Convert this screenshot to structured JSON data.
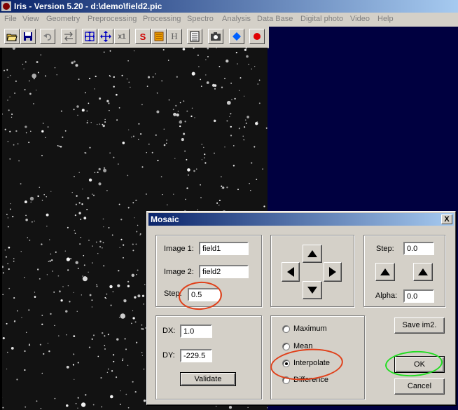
{
  "window": {
    "title": "Iris - Version 5.20 - d:\\demo\\field2.pic"
  },
  "menu": [
    "File",
    "View",
    "Geometry",
    "Preprocessing",
    "Processing",
    "Spectro",
    "Analysis",
    "Data Base",
    "Digital photo",
    "Video",
    "Help"
  ],
  "toolbar": {
    "icons": [
      "open-folder-icon",
      "save-disk-icon",
      "undo-icon",
      "transfer-icon",
      "zoom-in-icon",
      "move-cross-icon",
      "zoom-x1-icon",
      "red-s-icon",
      "histogram-icon",
      "header-icon",
      "list-icon",
      "camera-icon",
      "blue-diamond-icon",
      "red-dot-icon"
    ],
    "x1_label": "x1",
    "h_label": "H",
    "s_label": "S"
  },
  "mosaic": {
    "title": "Mosaic",
    "close": "X",
    "image1_label": "Image 1:",
    "image1_value": "field1",
    "image2_label": "Image 2:",
    "image2_value": "field2",
    "step_label": "Step:",
    "step_value": "0.5",
    "dx_label": "DX:",
    "dx_value": "1.0",
    "dy_label": "DY:",
    "dy_value": "-229.5",
    "validate": "Validate",
    "options": [
      {
        "label": "Maximum",
        "selected": false
      },
      {
        "label": "Mean",
        "selected": false
      },
      {
        "label": "Interpolate",
        "selected": true
      },
      {
        "label": "Difference",
        "selected": false
      }
    ],
    "right_step_label": "Step:",
    "right_step_value": "0.0",
    "alpha_label": "Alpha:",
    "alpha_value": "0.0",
    "save_im2": "Save im2.",
    "ok": "OK",
    "cancel": "Cancel"
  },
  "colors": {
    "title_start": "#0a246a",
    "title_end": "#a6caf0",
    "chrome": "#d4d0c8",
    "workspace": "#000040",
    "annotation_red": "#e0401a",
    "annotation_green": "#22dd22"
  }
}
